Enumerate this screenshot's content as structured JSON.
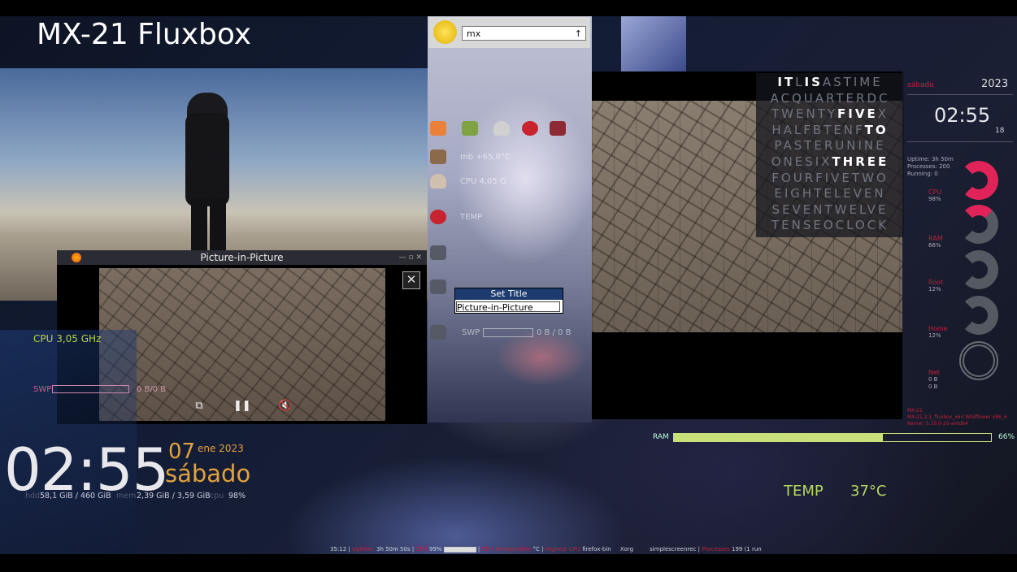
{
  "desktop": {
    "title": "MX-21 Fluxbox"
  },
  "pip": {
    "title": "Picture-in-Picture",
    "close": "✕"
  },
  "launcher": {
    "combo_value": "mx",
    "combo_arrow": "↑"
  },
  "mid_labels": {
    "temp_cpu": "mb +65,0°C",
    "cpu": "CPU 4,05 G",
    "temp": "TEMP",
    "swp": "SWP",
    "swp_val": "0 B / 0 B"
  },
  "set_title": {
    "header": "Set Title",
    "value": "Picture-in-Picture"
  },
  "word_clock": {
    "rows": [
      [
        {
          "t": "IT",
          "on": true
        },
        {
          "t": "L",
          "on": false
        },
        {
          "t": "IS",
          "on": true
        },
        {
          "t": "ASTIME",
          "on": false
        }
      ],
      [
        {
          "t": "ACQUARTERDC",
          "on": false
        }
      ],
      [
        {
          "t": "TWENTY",
          "on": false
        },
        {
          "t": "FIVE",
          "on": true
        },
        {
          "t": "X",
          "on": false
        }
      ],
      [
        {
          "t": "HALFBTENF",
          "on": false
        },
        {
          "t": "TO",
          "on": true
        }
      ],
      [
        {
          "t": "PASTERUNINE",
          "on": false
        }
      ],
      [
        {
          "t": "ONESIX",
          "on": false
        },
        {
          "t": "THREE",
          "on": true
        }
      ],
      [
        {
          "t": "FOURFIVETWO",
          "on": false
        }
      ],
      [
        {
          "t": "EIGHTELEVEN",
          "on": false
        }
      ],
      [
        {
          "t": "SEVENTWELVE",
          "on": false
        }
      ],
      [
        {
          "t": "TENSEOCLOCK",
          "on": false
        }
      ]
    ]
  },
  "right_conky": {
    "day": "sábado",
    "year": "2023",
    "time": "02:55",
    "seconds": "18",
    "uptime": "Uptime: 3h 50m",
    "processes": "Processes: 200",
    "running": "Running: 0",
    "gauges": [
      {
        "label": "CPU",
        "value": "98%",
        "percent": 98
      },
      {
        "label": "RAM",
        "value": "66%",
        "percent": 66
      },
      {
        "label": "Root",
        "value": "12%",
        "percent": 12
      },
      {
        "label": "Home",
        "value": "12%",
        "percent": 12
      },
      {
        "label": "Net",
        "value": "0 B",
        "value2": "0 B",
        "percent": 0
      }
    ],
    "sys_line1": "MX-21",
    "sys_line2": "MX-21.2.1_fluxbox_x64 Wildflower x86_6",
    "sys_line3": "Kernel: 5.10.0-20-amd64"
  },
  "left_conky": {
    "cpu": "CPU 3,05 GHz",
    "swp_label": "SWP",
    "swp_value": "0 B/0 B",
    "time": "02:55",
    "day_num": "07",
    "month_year": "ene 2023",
    "weekday": "sábado",
    "disk_label": "hdd",
    "disk_value": "58,1 GiB / 460 GiB",
    "mem_label": "mem",
    "mem_value": "2,39 GiB / 3,59 GiB",
    "cpu_label": "cpu",
    "cpu_value": "98%"
  },
  "ram": {
    "label": "RAM",
    "percent_text": "66%",
    "fraction": 0.66
  },
  "temp": {
    "label": "TEMP",
    "value": "37°C"
  },
  "statusbar": {
    "time": "35:12",
    "uptime_label": "Uptime:",
    "uptime_value": "3h 50m 50s",
    "cpu_label": "CPU",
    "cpu_value": "99%",
    "temp_label": "CPU Temperature",
    "temp_value": "°C",
    "highest_label": "Highest CPU",
    "highest_value": "firefox-bin",
    "xorg": "Xorg",
    "screenrec": "simplescreenrec",
    "proc_label": "Processes",
    "proc_value": "199 (1 run"
  },
  "colors": {
    "accent_red": "#c0213d",
    "accent_green": "#b5d860",
    "accent_orange": "#e2a23b"
  }
}
